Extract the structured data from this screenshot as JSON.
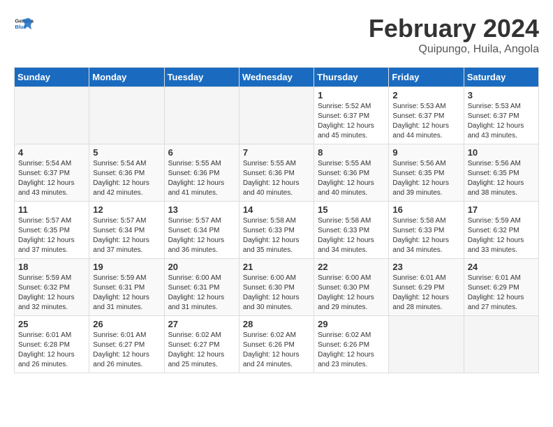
{
  "header": {
    "logo_general": "General",
    "logo_blue": "Blue",
    "month_title": "February 2024",
    "location": "Quipungo, Huila, Angola"
  },
  "days_of_week": [
    "Sunday",
    "Monday",
    "Tuesday",
    "Wednesday",
    "Thursday",
    "Friday",
    "Saturday"
  ],
  "weeks": [
    [
      {
        "day": "",
        "info": ""
      },
      {
        "day": "",
        "info": ""
      },
      {
        "day": "",
        "info": ""
      },
      {
        "day": "",
        "info": ""
      },
      {
        "day": "1",
        "info": "Sunrise: 5:52 AM\nSunset: 6:37 PM\nDaylight: 12 hours\nand 45 minutes."
      },
      {
        "day": "2",
        "info": "Sunrise: 5:53 AM\nSunset: 6:37 PM\nDaylight: 12 hours\nand 44 minutes."
      },
      {
        "day": "3",
        "info": "Sunrise: 5:53 AM\nSunset: 6:37 PM\nDaylight: 12 hours\nand 43 minutes."
      }
    ],
    [
      {
        "day": "4",
        "info": "Sunrise: 5:54 AM\nSunset: 6:37 PM\nDaylight: 12 hours\nand 43 minutes."
      },
      {
        "day": "5",
        "info": "Sunrise: 5:54 AM\nSunset: 6:36 PM\nDaylight: 12 hours\nand 42 minutes."
      },
      {
        "day": "6",
        "info": "Sunrise: 5:55 AM\nSunset: 6:36 PM\nDaylight: 12 hours\nand 41 minutes."
      },
      {
        "day": "7",
        "info": "Sunrise: 5:55 AM\nSunset: 6:36 PM\nDaylight: 12 hours\nand 40 minutes."
      },
      {
        "day": "8",
        "info": "Sunrise: 5:55 AM\nSunset: 6:36 PM\nDaylight: 12 hours\nand 40 minutes."
      },
      {
        "day": "9",
        "info": "Sunrise: 5:56 AM\nSunset: 6:35 PM\nDaylight: 12 hours\nand 39 minutes."
      },
      {
        "day": "10",
        "info": "Sunrise: 5:56 AM\nSunset: 6:35 PM\nDaylight: 12 hours\nand 38 minutes."
      }
    ],
    [
      {
        "day": "11",
        "info": "Sunrise: 5:57 AM\nSunset: 6:35 PM\nDaylight: 12 hours\nand 37 minutes."
      },
      {
        "day": "12",
        "info": "Sunrise: 5:57 AM\nSunset: 6:34 PM\nDaylight: 12 hours\nand 37 minutes."
      },
      {
        "day": "13",
        "info": "Sunrise: 5:57 AM\nSunset: 6:34 PM\nDaylight: 12 hours\nand 36 minutes."
      },
      {
        "day": "14",
        "info": "Sunrise: 5:58 AM\nSunset: 6:33 PM\nDaylight: 12 hours\nand 35 minutes."
      },
      {
        "day": "15",
        "info": "Sunrise: 5:58 AM\nSunset: 6:33 PM\nDaylight: 12 hours\nand 34 minutes."
      },
      {
        "day": "16",
        "info": "Sunrise: 5:58 AM\nSunset: 6:33 PM\nDaylight: 12 hours\nand 34 minutes."
      },
      {
        "day": "17",
        "info": "Sunrise: 5:59 AM\nSunset: 6:32 PM\nDaylight: 12 hours\nand 33 minutes."
      }
    ],
    [
      {
        "day": "18",
        "info": "Sunrise: 5:59 AM\nSunset: 6:32 PM\nDaylight: 12 hours\nand 32 minutes."
      },
      {
        "day": "19",
        "info": "Sunrise: 5:59 AM\nSunset: 6:31 PM\nDaylight: 12 hours\nand 31 minutes."
      },
      {
        "day": "20",
        "info": "Sunrise: 6:00 AM\nSunset: 6:31 PM\nDaylight: 12 hours\nand 31 minutes."
      },
      {
        "day": "21",
        "info": "Sunrise: 6:00 AM\nSunset: 6:30 PM\nDaylight: 12 hours\nand 30 minutes."
      },
      {
        "day": "22",
        "info": "Sunrise: 6:00 AM\nSunset: 6:30 PM\nDaylight: 12 hours\nand 29 minutes."
      },
      {
        "day": "23",
        "info": "Sunrise: 6:01 AM\nSunset: 6:29 PM\nDaylight: 12 hours\nand 28 minutes."
      },
      {
        "day": "24",
        "info": "Sunrise: 6:01 AM\nSunset: 6:29 PM\nDaylight: 12 hours\nand 27 minutes."
      }
    ],
    [
      {
        "day": "25",
        "info": "Sunrise: 6:01 AM\nSunset: 6:28 PM\nDaylight: 12 hours\nand 26 minutes."
      },
      {
        "day": "26",
        "info": "Sunrise: 6:01 AM\nSunset: 6:27 PM\nDaylight: 12 hours\nand 26 minutes."
      },
      {
        "day": "27",
        "info": "Sunrise: 6:02 AM\nSunset: 6:27 PM\nDaylight: 12 hours\nand 25 minutes."
      },
      {
        "day": "28",
        "info": "Sunrise: 6:02 AM\nSunset: 6:26 PM\nDaylight: 12 hours\nand 24 minutes."
      },
      {
        "day": "29",
        "info": "Sunrise: 6:02 AM\nSunset: 6:26 PM\nDaylight: 12 hours\nand 23 minutes."
      },
      {
        "day": "",
        "info": ""
      },
      {
        "day": "",
        "info": ""
      }
    ]
  ]
}
